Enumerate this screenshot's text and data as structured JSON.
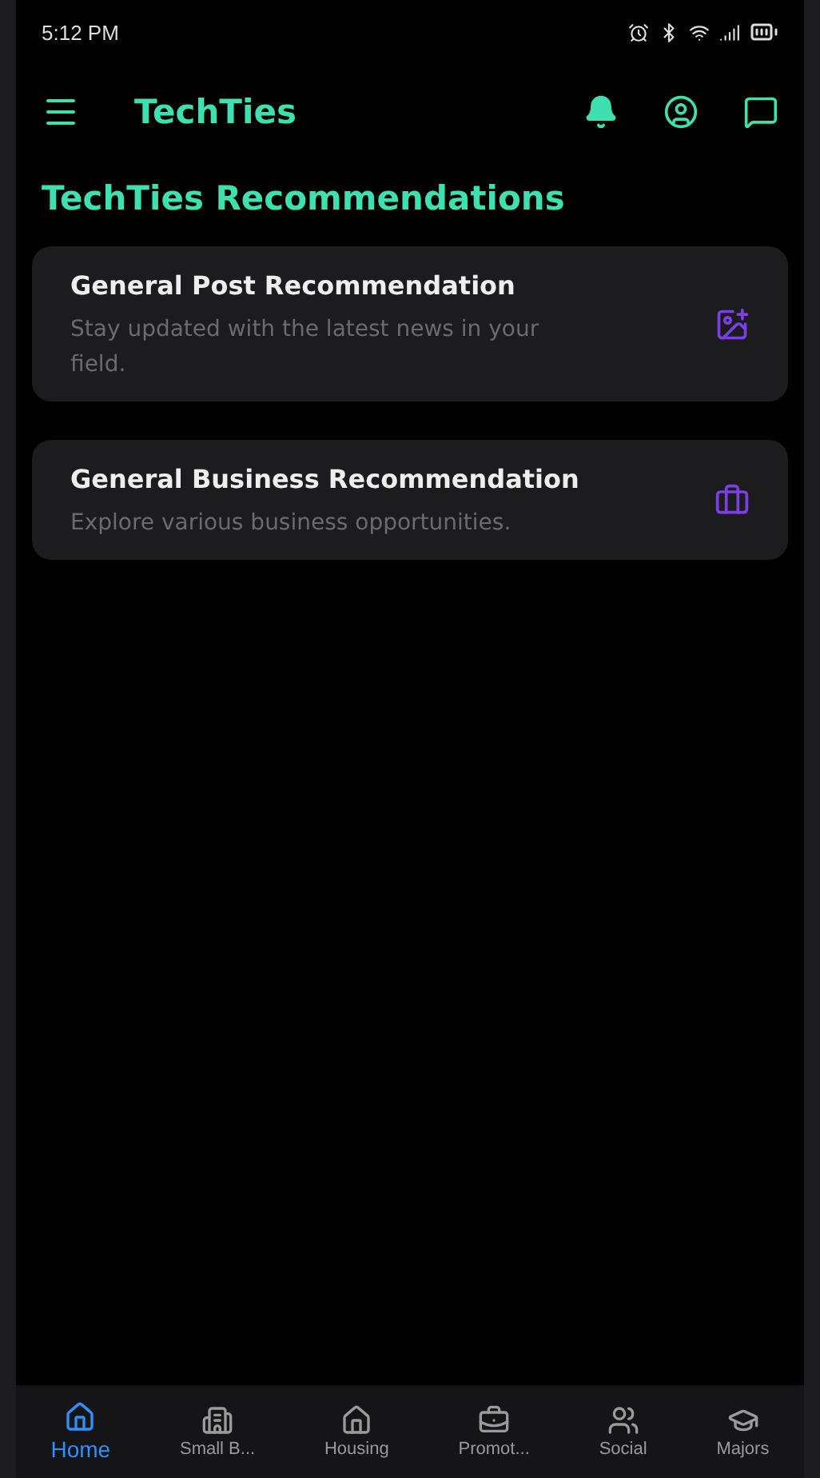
{
  "status_bar": {
    "time": "5:12 PM"
  },
  "app_bar": {
    "title": "TechTies"
  },
  "heading": "TechTies Recommendations",
  "cards": [
    {
      "title": "General Post Recommendation",
      "description": "Stay updated with the latest news in your field."
    },
    {
      "title": "General Business Recommendation",
      "description": "Explore various business opportunities."
    }
  ],
  "bottom_nav": [
    {
      "label": "Home",
      "selected": true
    },
    {
      "label": "Small B...",
      "selected": false
    },
    {
      "label": "Housing",
      "selected": false
    },
    {
      "label": "Promot...",
      "selected": false
    },
    {
      "label": "Social",
      "selected": false
    },
    {
      "label": "Majors",
      "selected": false
    }
  ]
}
